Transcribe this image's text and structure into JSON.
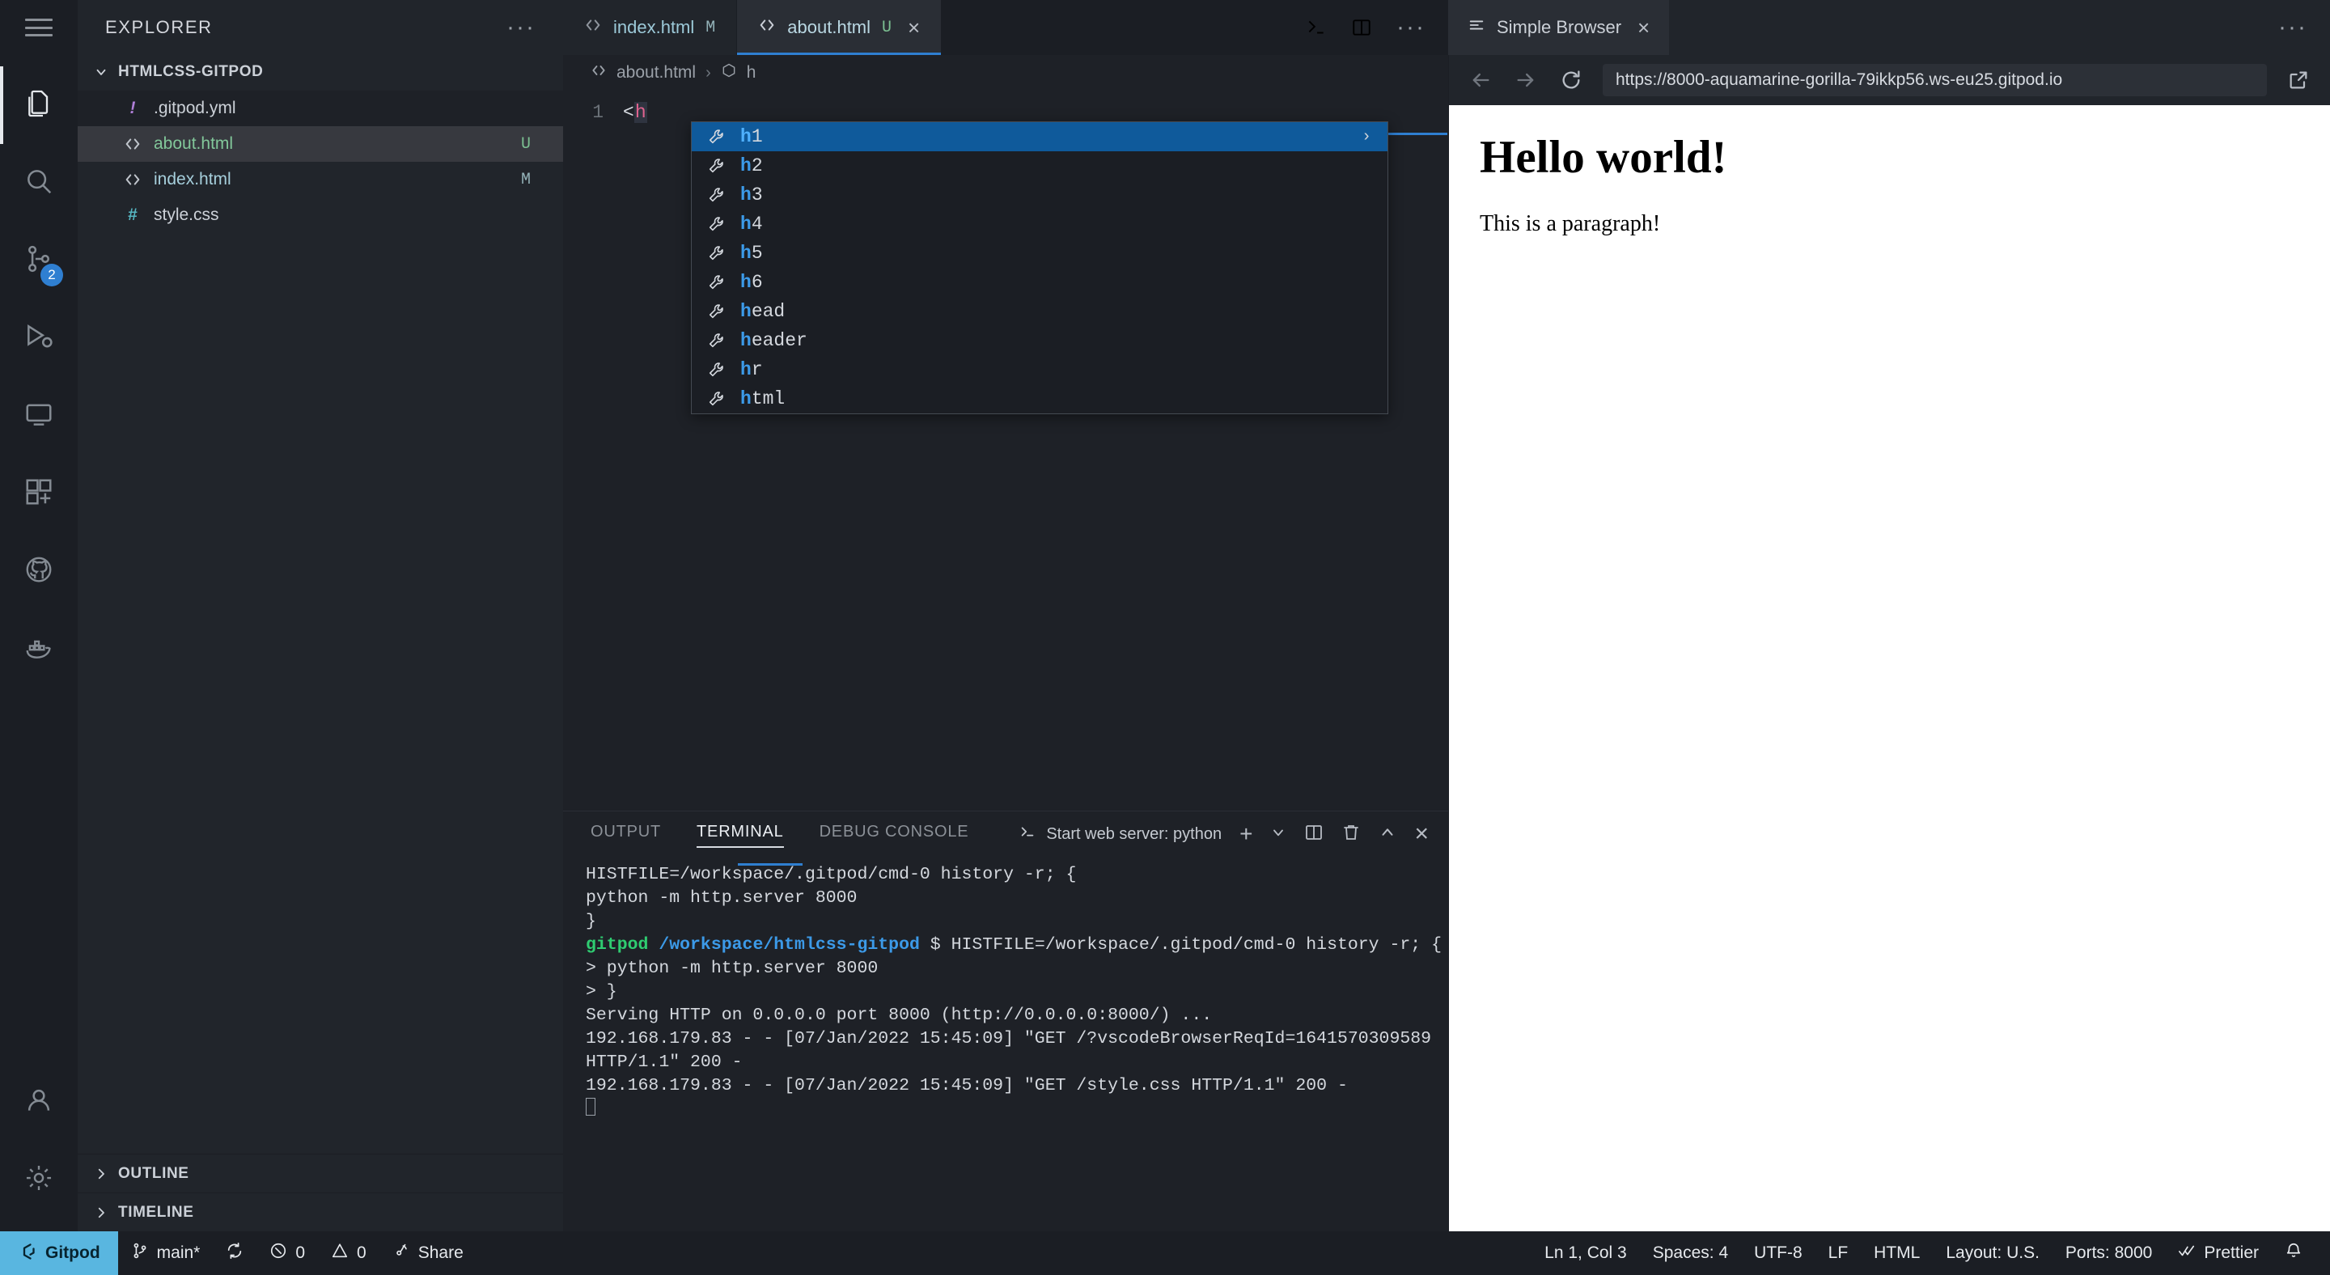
{
  "window": {
    "hamburger_icon": "hamburger-menu-icon"
  },
  "sidebar": {
    "title": "EXPLORER",
    "more_actions": "···",
    "folder": {
      "name": "HTMLCSS-GITPOD",
      "chevron": "chevron-down-icon"
    },
    "files": [
      {
        "name": ".gitpod.yml",
        "icon": "!",
        "icon_kind": "yaml-icon",
        "badge": "",
        "badge_kind": "",
        "state": "hl"
      },
      {
        "name": "about.html",
        "icon": "<>",
        "icon_kind": "html-icon",
        "badge": "U",
        "badge_kind": "untracked",
        "state": "sel"
      },
      {
        "name": "index.html",
        "icon": "<>",
        "icon_kind": "html-icon",
        "badge": "M",
        "badge_kind": "modified",
        "state": ""
      },
      {
        "name": "style.css",
        "icon": "#",
        "icon_kind": "css-icon",
        "badge": "",
        "badge_kind": "",
        "state": ""
      }
    ],
    "sections": [
      {
        "label": "OUTLINE",
        "chevron": "chevron-right-icon"
      },
      {
        "label": "TIMELINE",
        "chevron": "chevron-right-icon"
      }
    ]
  },
  "activitybar": {
    "items": [
      {
        "name": "explorer",
        "icon": "files-icon",
        "badge": "",
        "active": true
      },
      {
        "name": "search",
        "icon": "search-icon",
        "badge": ""
      },
      {
        "name": "source-control",
        "icon": "source-control-icon",
        "badge": "2"
      },
      {
        "name": "run-and-debug",
        "icon": "run-debug-icon",
        "badge": ""
      },
      {
        "name": "remote-explorer",
        "icon": "remote-explorer-icon",
        "badge": ""
      },
      {
        "name": "extensions",
        "icon": "extensions-icon",
        "badge": ""
      },
      {
        "name": "github",
        "icon": "github-icon",
        "badge": ""
      },
      {
        "name": "docker",
        "icon": "docker-icon",
        "badge": ""
      }
    ],
    "bottom": [
      {
        "name": "accounts",
        "icon": "account-icon"
      },
      {
        "name": "settings",
        "icon": "gear-icon"
      }
    ]
  },
  "editor": {
    "tabs": [
      {
        "label": "index.html",
        "badge": "M",
        "badge_kind": "modified",
        "icon": "html-icon",
        "active": false,
        "closable": false
      },
      {
        "label": "about.html",
        "badge": "U",
        "badge_kind": "untracked",
        "icon": "html-icon",
        "active": true,
        "closable": true
      }
    ],
    "tab_close_glyph": "×",
    "actions": [
      {
        "name": "run-or-preview",
        "icon": "preview-icon"
      },
      {
        "name": "split-editor",
        "icon": "split-editor-icon"
      },
      {
        "name": "more-actions",
        "icon": "ellipsis-icon",
        "glyph": "···"
      }
    ],
    "breadcrumb": {
      "file_icon": "html-icon",
      "file": "about.html",
      "separator": "›",
      "symbol_icon": "symbol-field-icon",
      "symbol": "h"
    },
    "line_number": "1",
    "code_before": "<",
    "code_tag": "h",
    "suggestions": {
      "icon": "wrench-icon",
      "match_prefix": "h",
      "items": [
        {
          "label": "h1",
          "selected": true,
          "has_detail_arrow": true
        },
        {
          "label": "h2",
          "selected": false,
          "has_detail_arrow": false
        },
        {
          "label": "h3",
          "selected": false,
          "has_detail_arrow": false
        },
        {
          "label": "h4",
          "selected": false,
          "has_detail_arrow": false
        },
        {
          "label": "h5",
          "selected": false,
          "has_detail_arrow": false
        },
        {
          "label": "h6",
          "selected": false,
          "has_detail_arrow": false
        },
        {
          "label": "head",
          "selected": false,
          "has_detail_arrow": false
        },
        {
          "label": "header",
          "selected": false,
          "has_detail_arrow": false
        },
        {
          "label": "hr",
          "selected": false,
          "has_detail_arrow": false
        },
        {
          "label": "html",
          "selected": false,
          "has_detail_arrow": false
        }
      ],
      "detail_arrow_glyph": "›"
    }
  },
  "browser": {
    "tab_label": "Simple Browser",
    "tab_icon": "browser-icon",
    "tab_close_glyph": "×",
    "more_actions_glyph": "···",
    "toolbar": {
      "back_icon": "arrow-left-icon",
      "forward_icon": "arrow-right-icon",
      "reload_icon": "reload-icon",
      "open_external_icon": "open-external-icon",
      "url": "https://8000-aquamarine-gorilla-79ikkp56.ws-eu25.gitpod.io"
    },
    "page": {
      "heading": "Hello world!",
      "paragraph": "This is a paragraph!"
    }
  },
  "panel": {
    "tabs": [
      {
        "label": "OUTPUT",
        "active": false
      },
      {
        "label": "TERMINAL",
        "active": true
      },
      {
        "label": "DEBUG CONSOLE",
        "active": false
      }
    ],
    "terminal_selector": "Start web server: python",
    "terminal_selector_icon": "terminal-icon",
    "actions": [
      {
        "name": "new-terminal",
        "icon": "plus-icon",
        "glyph": "+"
      },
      {
        "name": "terminal-dropdown",
        "icon": "chevron-down-icon"
      },
      {
        "name": "split-terminal",
        "icon": "split-icon"
      },
      {
        "name": "kill-terminal",
        "icon": "trash-icon"
      },
      {
        "name": "maximize-panel",
        "icon": "chevron-up-icon"
      },
      {
        "name": "close-panel",
        "icon": "close-icon",
        "glyph": "×"
      }
    ],
    "terminal_lines": [
      {
        "segments": [
          {
            "text": " HISTFILE=/workspace/.gitpod/cmd-0 history -r; {",
            "color": "white"
          }
        ]
      },
      {
        "segments": [
          {
            "text": "python -m http.server 8000",
            "color": "white"
          }
        ]
      },
      {
        "segments": [
          {
            "text": "}",
            "color": "white"
          }
        ]
      },
      {
        "segments": [
          {
            "text": "gitpod",
            "color": "green"
          },
          {
            "text": " ",
            "color": "white"
          },
          {
            "text": "/workspace/htmlcss-gitpod",
            "color": "blue"
          },
          {
            "text": " $  HISTFILE=/workspace/.gitpod/cmd-0 history -r; {",
            "color": "white"
          }
        ]
      },
      {
        "segments": [
          {
            "text": "> python -m http.server 8000",
            "color": "white"
          }
        ]
      },
      {
        "segments": [
          {
            "text": "> }",
            "color": "white"
          }
        ]
      },
      {
        "segments": [
          {
            "text": "Serving HTTP on 0.0.0.0 port 8000 (http://0.0.0.0:8000/) ...",
            "color": "white"
          }
        ]
      },
      {
        "segments": [
          {
            "text": "192.168.179.83 - - [07/Jan/2022 15:45:09] \"GET /?vscodeBrowserReqId=1641570309589 HTTP/1.1\" 200 -",
            "color": "white"
          }
        ]
      },
      {
        "segments": [
          {
            "text": "192.168.179.83 - - [07/Jan/2022 15:45:09] \"GET /style.css HTTP/1.1\" 200 -",
            "color": "white"
          }
        ]
      }
    ]
  },
  "statusbar": {
    "gitpod": {
      "label": "Gitpod",
      "icon": "gitpod-icon"
    },
    "branch": {
      "label": "main*",
      "icon": "git-branch-icon"
    },
    "sync": {
      "icon": "sync-icon"
    },
    "errors": {
      "count": "0",
      "icon": "error-icon"
    },
    "warnings": {
      "count": "0",
      "icon": "warning-icon"
    },
    "share": {
      "label": "Share",
      "icon": "broadcast-icon"
    },
    "right": [
      {
        "name": "cursor-position",
        "label": "Ln 1, Col 3"
      },
      {
        "name": "indentation",
        "label": "Spaces: 4"
      },
      {
        "name": "encoding",
        "label": "UTF-8"
      },
      {
        "name": "eol",
        "label": "LF"
      },
      {
        "name": "language-mode",
        "label": "HTML"
      },
      {
        "name": "keyboard-layout",
        "label": "Layout: U.S."
      },
      {
        "name": "ports",
        "label": "Ports: 8000"
      },
      {
        "name": "prettier",
        "label": "Prettier",
        "icon": "checkmarks-icon"
      }
    ],
    "notifications_icon": "bell-icon"
  },
  "colors": {
    "accent_blue": "#2f7fd1",
    "selection_blue": "#0f5a9b",
    "gitpod_blue": "#59b6e0",
    "untracked_green": "#7bbf91",
    "modified_gray": "#93b2b8",
    "terminal_green": "#2fcc71",
    "terminal_blue": "#3c9ae8",
    "html_icon_orange": "#e07b39"
  }
}
